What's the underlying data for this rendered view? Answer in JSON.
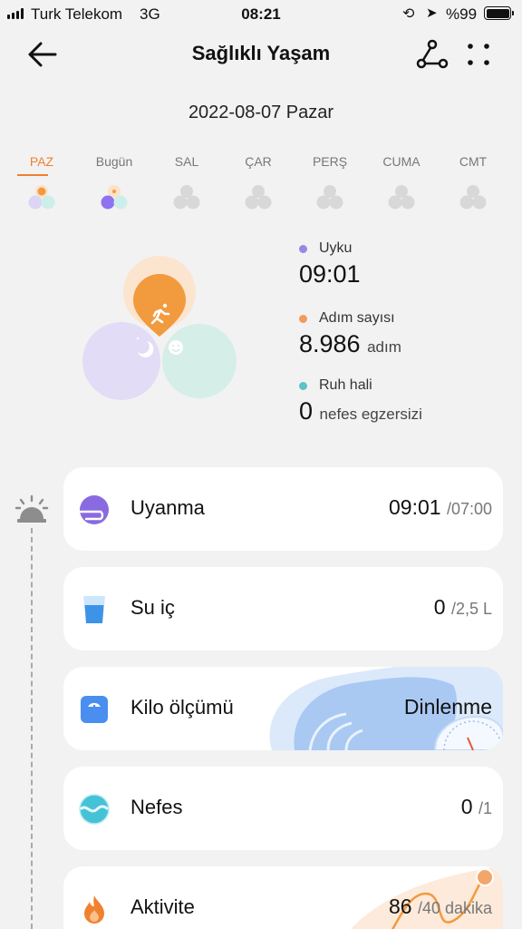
{
  "status_bar": {
    "carrier": "Turk Telekom",
    "network": "3G",
    "time": "08:21",
    "battery": "%99"
  },
  "header": {
    "title": "Sağlıklı Yaşam",
    "back_icon": "back-arrow-icon",
    "share_icon": "share-icon",
    "more_icon": "more-dots-icon"
  },
  "date": "2022-08-07 Pazar",
  "days": [
    {
      "label": "PAZ",
      "active": true
    },
    {
      "label": "Bugün",
      "active": false
    },
    {
      "label": "SAL",
      "active": false
    },
    {
      "label": "ÇAR",
      "active": false
    },
    {
      "label": "PERŞ",
      "active": false
    },
    {
      "label": "CUMA",
      "active": false
    },
    {
      "label": "CMT",
      "active": false
    }
  ],
  "summary": [
    {
      "label": "Uyku",
      "value": "09:01",
      "unit": "",
      "color": "#9a86e6"
    },
    {
      "label": "Adım sayısı",
      "value": "8.986",
      "unit": "adım",
      "color": "#f39a5d"
    },
    {
      "label": "Ruh hali",
      "value": "0",
      "unit": "nefes egzersizi",
      "color": "#5fc1c8"
    }
  ],
  "colors": {
    "accent": "#f0812f",
    "sleep": "#e3dcf6",
    "mood": "#d3eee8",
    "activity": "#f29a3e"
  },
  "cards": [
    {
      "name": "Uyanma",
      "value": "09:01",
      "target": "/07:00",
      "icon": "wake-up-icon"
    },
    {
      "name": "Su iç",
      "value": "0",
      "target": "/2,5 L",
      "icon": "water-glass-icon"
    },
    {
      "name": "Kilo ölçümü",
      "value": "Dinlenme",
      "target": "",
      "icon": "scale-icon"
    },
    {
      "name": "Nefes",
      "value": "0",
      "target": "/1",
      "icon": "breath-icon"
    },
    {
      "name": "Aktivite",
      "value": "86",
      "target": "/40 dakika",
      "icon": "flame-icon"
    }
  ]
}
